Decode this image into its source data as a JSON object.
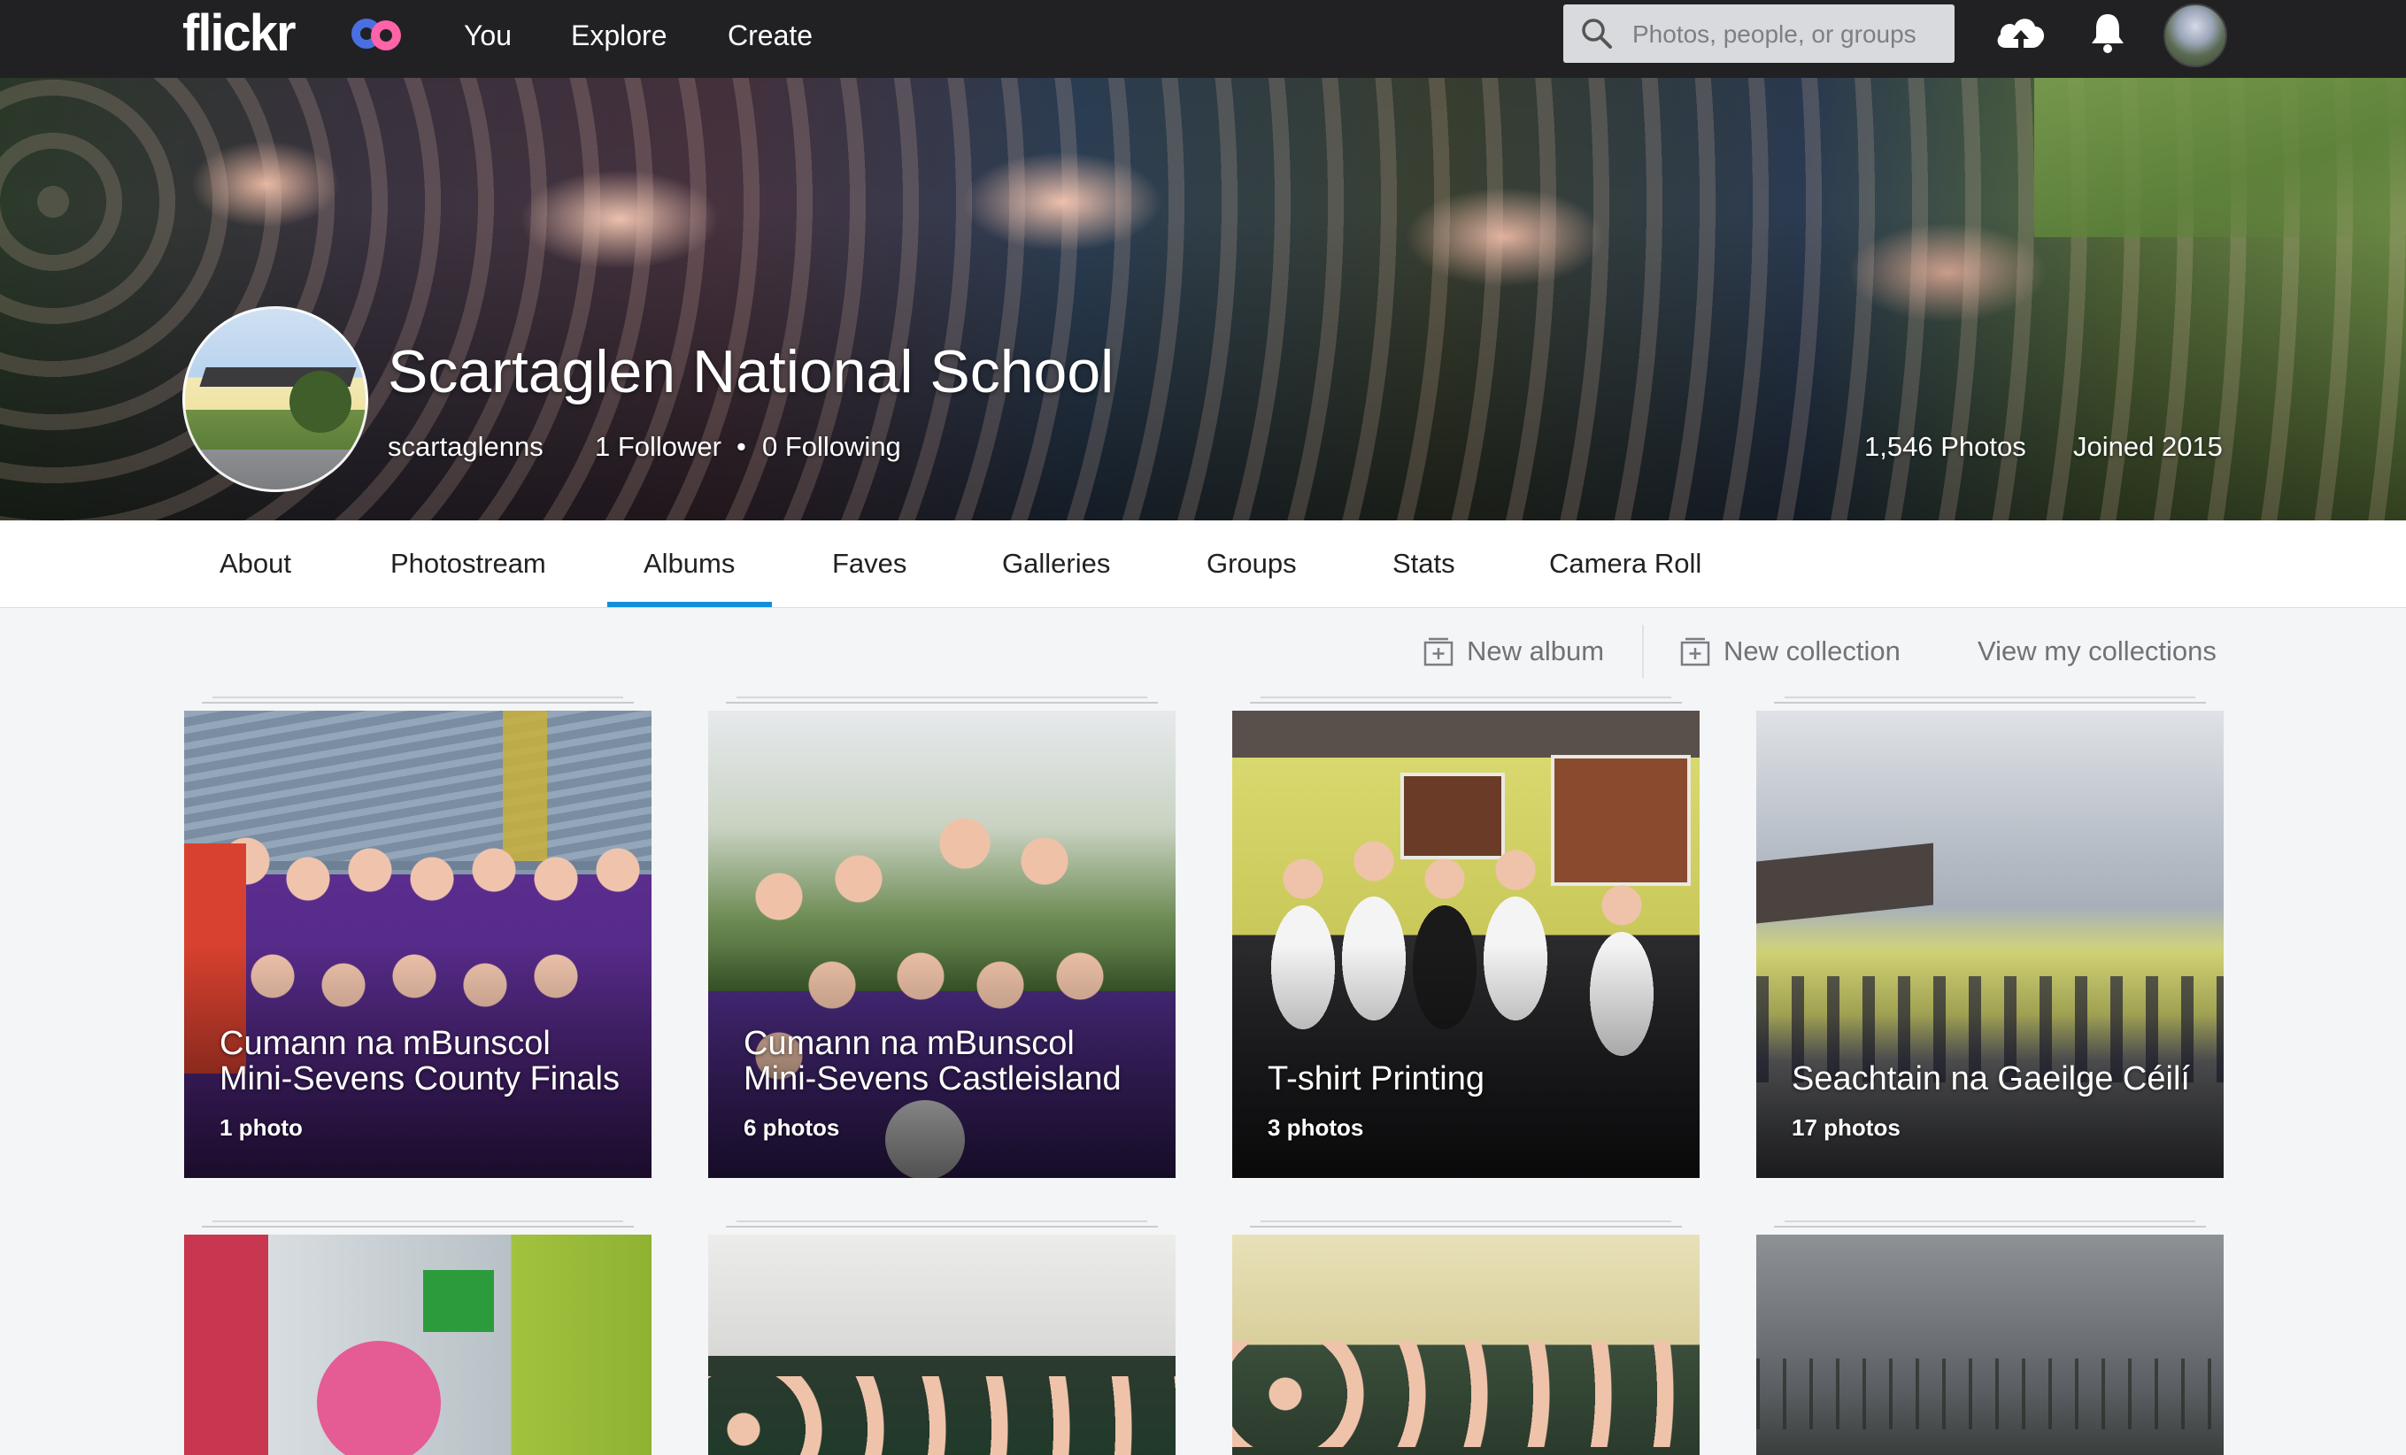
{
  "nav": {
    "logo": "flickr",
    "links": [
      "You",
      "Explore",
      "Create"
    ],
    "search_placeholder": "Photos, people, or groups"
  },
  "profile": {
    "display_name": "Scartaglen National School",
    "username": "scartaglenns",
    "followers": "1 Follower",
    "following": "0 Following",
    "photos": "1,546 Photos",
    "joined": "Joined 2015"
  },
  "tabs": {
    "about": "About",
    "photostream": "Photostream",
    "albums": "Albums",
    "faves": "Faves",
    "galleries": "Galleries",
    "groups": "Groups",
    "stats": "Stats",
    "camera_roll": "Camera Roll"
  },
  "actions": {
    "new_album": "New album",
    "new_collection": "New collection",
    "view_collections": "View my collections"
  },
  "albums": [
    {
      "title": "Cumann na mBunscol Mini-Sevens County Finals",
      "count": "1 photo"
    },
    {
      "title": "Cumann na mBunscol Mini-Sevens Castleisland",
      "count": "6 photos"
    },
    {
      "title": "T-shirt Printing",
      "count": "3 photos"
    },
    {
      "title": "Seachtain na Gaeilge Céilí",
      "count": "17 photos"
    }
  ],
  "colors": {
    "nav_bg": "#212124",
    "accent": "#128fdc",
    "page_bg": "#f3f5f6"
  }
}
